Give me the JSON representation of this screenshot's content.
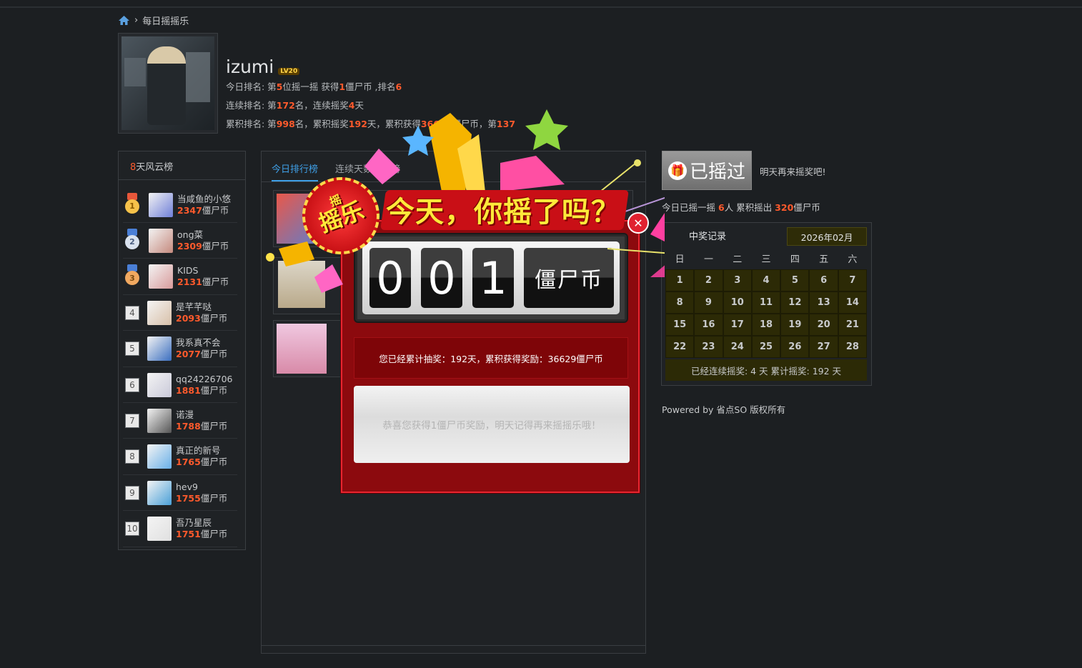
{
  "breadcrumb": {
    "current": "每日摇摇乐"
  },
  "user": {
    "name": "izumi",
    "level": "LV20",
    "today_rank": {
      "prefix": "今日排名: 第",
      "position": "5",
      "mid": "位摇一摇 获得",
      "coins": "1",
      "suffix": "僵尸币 ,排名",
      "rank": "6"
    },
    "streak_rank": {
      "prefix": "连续排名: 第",
      "rank": "172",
      "mid": "名，连续摇奖",
      "days": "4",
      "suffix": "天"
    },
    "total_rank": {
      "prefix": "累积排名: 第",
      "rank": "998",
      "mid1": "名，累积摇奖",
      "days": "192",
      "mid2": "天，累积获得",
      "coins": "36629",
      "mid3": "僵尸币，第",
      "tail": "137"
    }
  },
  "leaderboard": {
    "title_num": "8",
    "title": "天风云榜",
    "unit": "僵尸币",
    "items": [
      {
        "rank": "1",
        "name": "当咸鱼的小悠",
        "coins": "2347",
        "color": "#6f7fd8"
      },
      {
        "rank": "2",
        "name": "ong菜",
        "coins": "2309",
        "color": "#c58a7e"
      },
      {
        "rank": "3",
        "name": "KIDS",
        "coins": "2131",
        "color": "#d89b9b"
      },
      {
        "rank": "4",
        "name": "是芊芊哒",
        "coins": "2093",
        "color": "#d8c0a8"
      },
      {
        "rank": "5",
        "name": "我系真不会",
        "coins": "2077",
        "color": "#3b6fc0"
      },
      {
        "rank": "6",
        "name": "qq24226706",
        "coins": "1881",
        "color": "#c9c9d9"
      },
      {
        "rank": "7",
        "name": "诺漫",
        "coins": "1788",
        "color": "#555"
      },
      {
        "rank": "8",
        "name": "真正的新号",
        "coins": "1765",
        "color": "#6ab0e8"
      },
      {
        "rank": "9",
        "name": "hev9",
        "coins": "1755",
        "color": "#4aa0d8"
      },
      {
        "rank": "10",
        "name": "吾乃星辰",
        "coins": "1751",
        "color": "#e0e0e0"
      }
    ]
  },
  "tabs": [
    {
      "label": "今日排行榜",
      "active": true
    },
    {
      "label": "连续天数排行榜",
      "active": false
    }
  ],
  "shake": {
    "button": "已摇过",
    "note": "明天再来摇奖吧!",
    "today_prefix": "今日已摇一摇",
    "today_count": "6",
    "today_mid": "人 累积摇出",
    "today_coins": "320",
    "today_unit": "僵尸币"
  },
  "calendar": {
    "title": "中奖记录",
    "month": "2026年02月",
    "weekdays": [
      "日",
      "一",
      "二",
      "三",
      "四",
      "五",
      "六"
    ],
    "days": [
      "1",
      "2",
      "3",
      "4",
      "5",
      "6",
      "7",
      "8",
      "9",
      "10",
      "11",
      "12",
      "13",
      "14",
      "15",
      "16",
      "17",
      "18",
      "19",
      "20",
      "21",
      "22",
      "23",
      "24",
      "25",
      "26",
      "27",
      "28"
    ],
    "footer": "已经连续摇奖:   4 天  累计摇奖:   192 天"
  },
  "powered": "Powered by 省点SO 版权所有",
  "popup": {
    "badge": "摇乐",
    "badge_small": "摇",
    "banner": "今天，你摇了吗？",
    "digits": [
      "0",
      "0",
      "1"
    ],
    "unit": "僵尸币",
    "summary": "您已经累计抽奖：192天，累积获得奖励：36629僵尸币",
    "message": "恭喜您获得1僵尸币奖励，明天记得再来摇摇乐哦！",
    "close": "✕"
  },
  "colors": {
    "accent": "#ff5a2c",
    "tab_active": "#3fa0e8",
    "popup_red": "#8c0a0e"
  }
}
